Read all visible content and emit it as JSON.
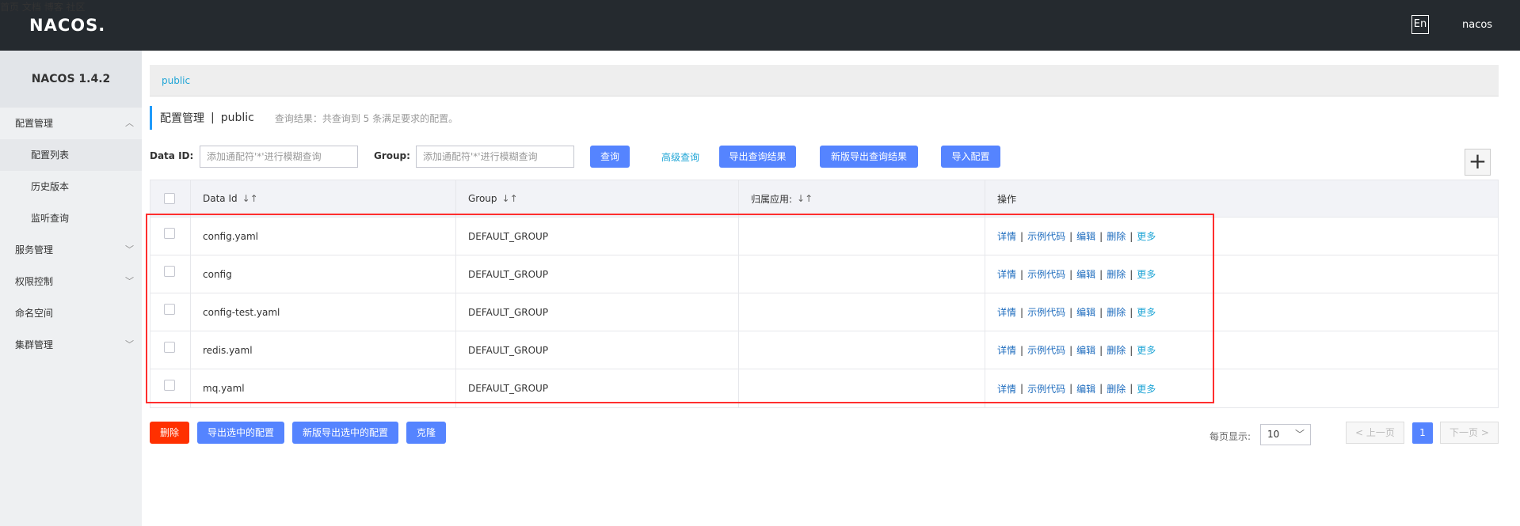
{
  "brand": {
    "logo": "NACOS",
    "logo_dot": "."
  },
  "topnav": {
    "home": "首页",
    "docs": "文档",
    "blog": "博客",
    "community": "社区",
    "lang": "En",
    "user": "nacos"
  },
  "sidebar": {
    "version": "NACOS 1.4.2",
    "config_mgmt": "配置管理",
    "config_list": "配置列表",
    "history": "历史版本",
    "listen_query": "监听查询",
    "service_mgmt": "服务管理",
    "auth_control": "权限控制",
    "namespace": "命名空间",
    "cluster_mgmt": "集群管理"
  },
  "breadcrumb": {
    "namespace": "public"
  },
  "title": {
    "main": "配置管理",
    "separator": "|",
    "namespace": "public",
    "result": "查询结果：共查询到 5 条满足要求的配置。"
  },
  "search": {
    "dataid_label": "Data ID:",
    "dataid_placeholder": "添加通配符'*'进行模糊查询",
    "group_label": "Group:",
    "group_placeholder": "添加通配符'*'进行模糊查询",
    "query_btn": "查询",
    "advanced_query": "高级查询",
    "export_results": "导出查询结果",
    "new_export_results": "新版导出查询结果",
    "import_config": "导入配置",
    "add_icon": "+"
  },
  "table": {
    "headers": {
      "dataid": "Data Id",
      "group": "Group",
      "app": "归属应用:",
      "ops": "操作",
      "sort": "↓↑"
    },
    "rows": [
      {
        "dataid": "config.yaml",
        "group": "DEFAULT_GROUP"
      },
      {
        "dataid": "config",
        "group": "DEFAULT_GROUP"
      },
      {
        "dataid": "config-test.yaml",
        "group": "DEFAULT_GROUP"
      },
      {
        "dataid": "redis.yaml",
        "group": "DEFAULT_GROUP"
      },
      {
        "dataid": "mq.yaml",
        "group": "DEFAULT_GROUP"
      }
    ],
    "ops": {
      "detail": "详情",
      "sample": "示例代码",
      "edit": "编辑",
      "delete": "删除",
      "more": "更多",
      "bar": "|"
    }
  },
  "footer": {
    "delete": "删除",
    "export_selected": "导出选中的配置",
    "new_export_selected": "新版导出选中的配置",
    "clone": "克隆",
    "page_size_label": "每页显示:",
    "page_size": "10",
    "prev": "上一页",
    "current_page": "1",
    "next": "下一页"
  },
  "colors": {
    "accent": "#5584ff",
    "danger": "#ff3000",
    "link": "#1fa5d6",
    "topbar": "#252a2f",
    "highlight_box": "#ff2e2e"
  }
}
